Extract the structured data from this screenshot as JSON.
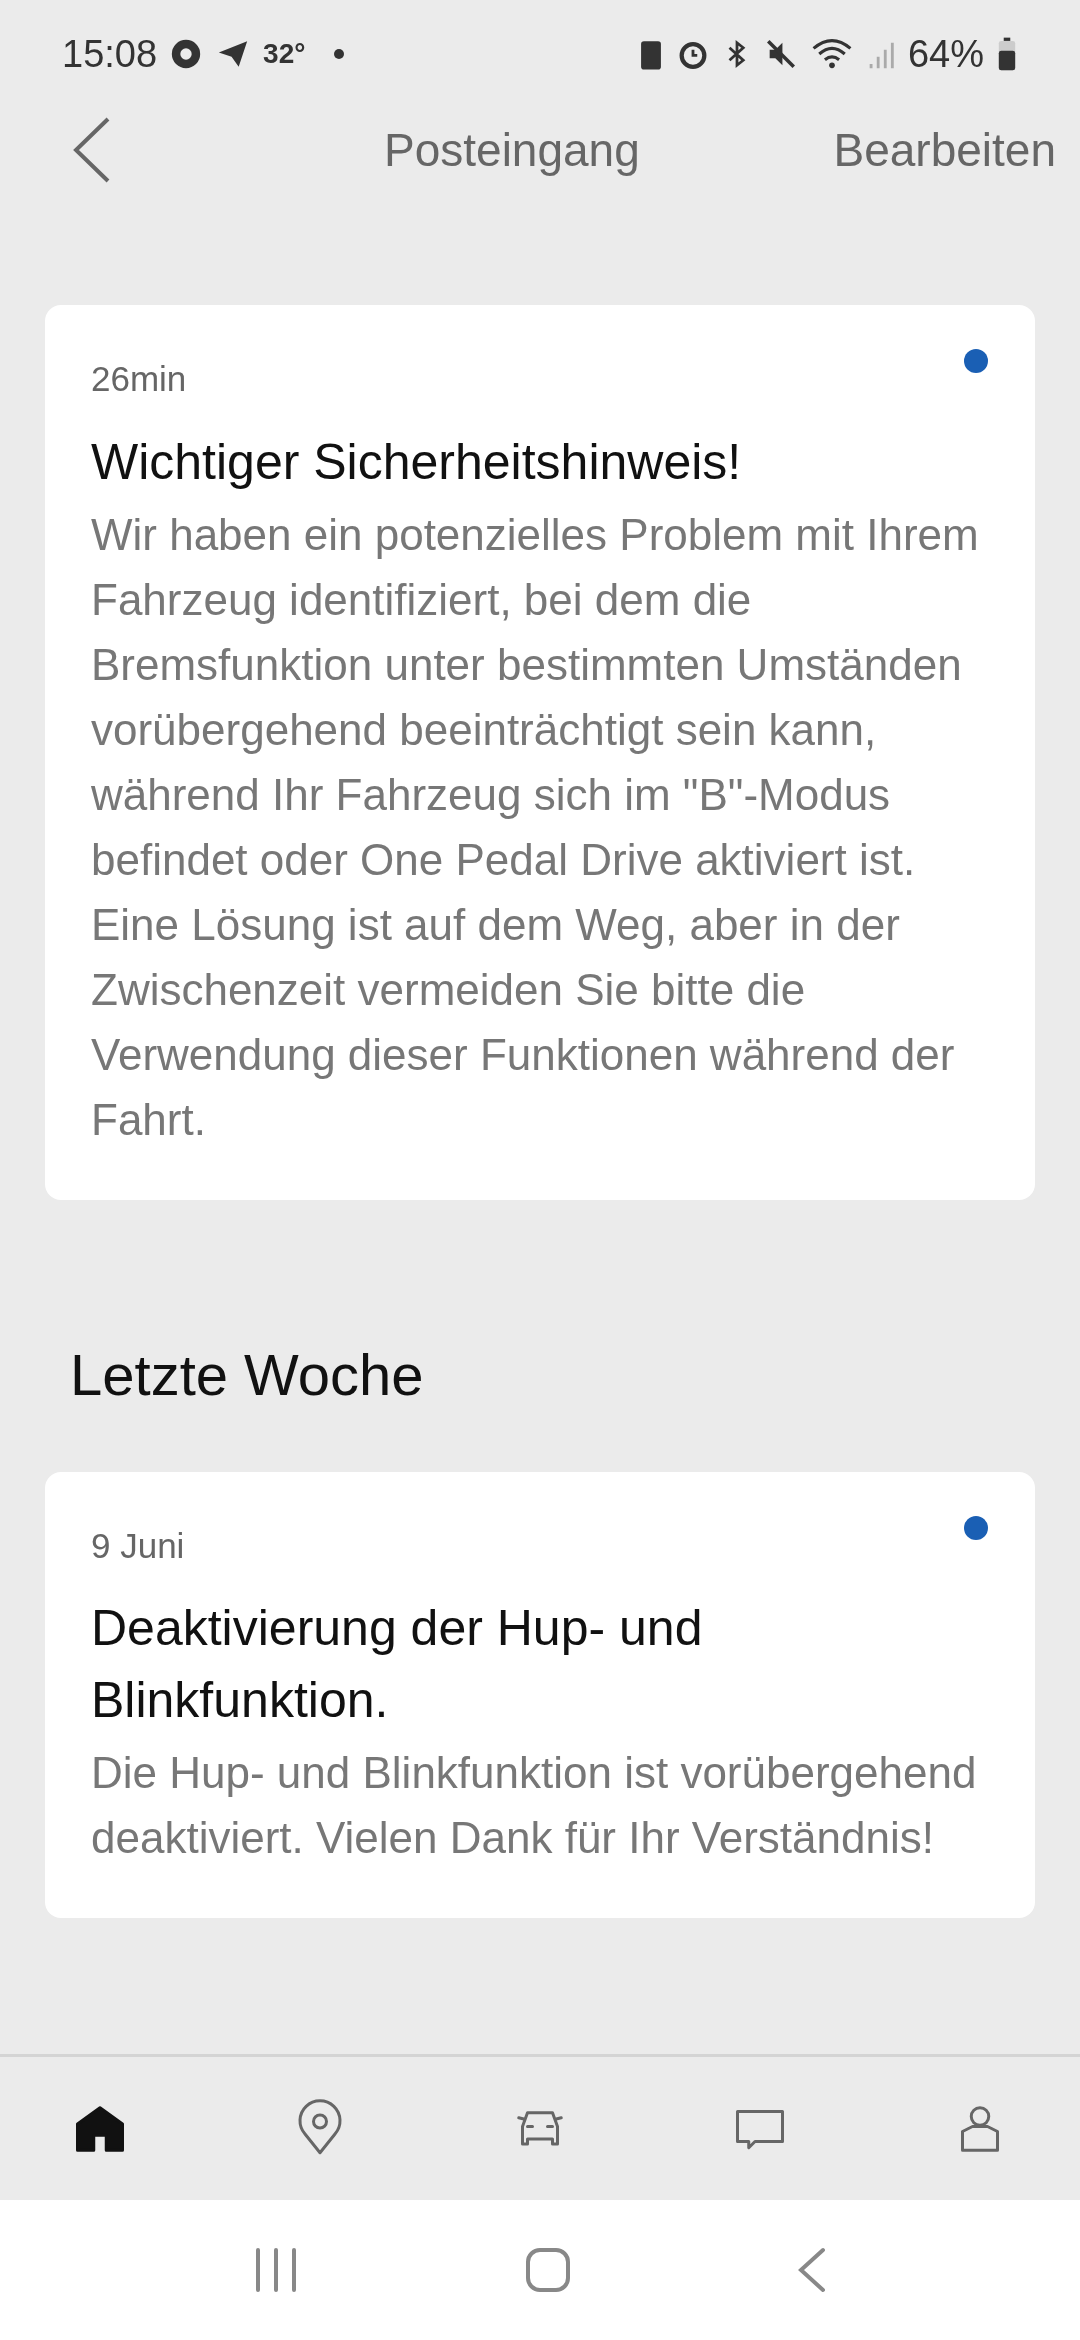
{
  "status_bar": {
    "time": "15:08",
    "temperature": "32°",
    "battery": "64%"
  },
  "header": {
    "title": "Posteingang",
    "action": "Bearbeiten"
  },
  "sections": [
    {
      "messages": [
        {
          "time": "26min",
          "unread": true,
          "title": "Wichtiger Sicherheitshinweis!",
          "body": "Wir haben ein potenzielles Problem mit Ihrem Fahrzeug identifiziert, bei dem die Bremsfunktion unter bestimmten Umständen vorübergehend beeinträchtigt sein kann, während Ihr Fahrzeug sich im \"B\"-Modus befindet oder One Pedal Drive aktiviert ist. Eine Lösung ist auf dem Weg, aber in der Zwischenzeit vermeiden Sie bitte die Verwendung dieser Funktionen während der Fahrt."
        }
      ]
    },
    {
      "heading": "Letzte Woche",
      "messages": [
        {
          "time": "9 Juni",
          "unread": true,
          "title": "Deaktivierung der Hup- und Blinkfunktion.",
          "body": "Die Hup- und Blinkfunktion ist vorübergehend deaktiviert. Vielen Dank für Ihr Verständnis!"
        }
      ]
    }
  ],
  "tab_bar": [
    {
      "kind": "home",
      "selected": true
    },
    {
      "kind": "map",
      "selected": false
    },
    {
      "kind": "car",
      "selected": false
    },
    {
      "kind": "chat",
      "selected": false
    },
    {
      "kind": "profile",
      "selected": false
    }
  ]
}
